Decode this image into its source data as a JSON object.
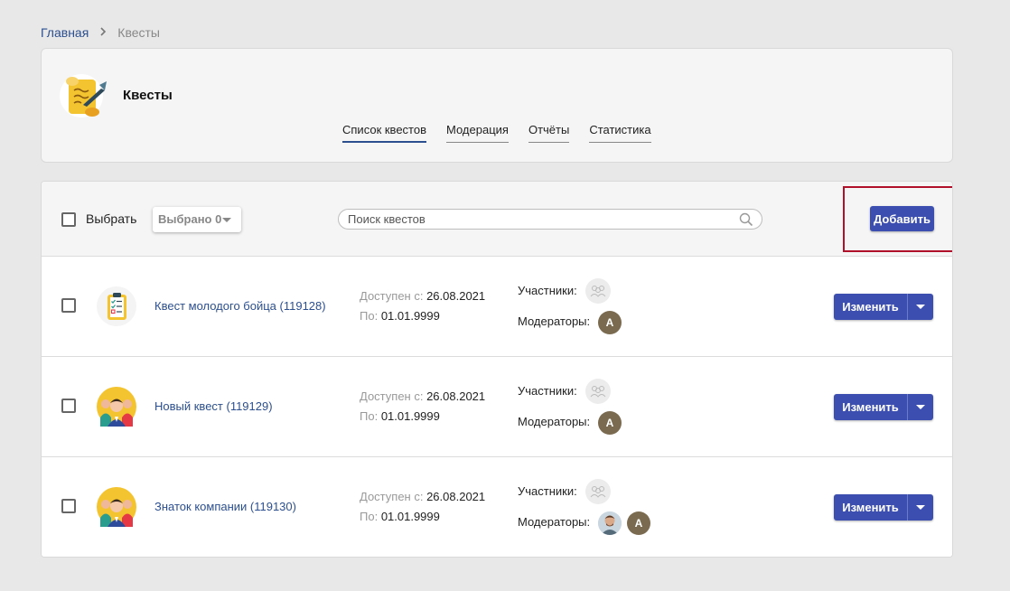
{
  "breadcrumb": {
    "home": "Главная",
    "current": "Квесты"
  },
  "header": {
    "title": "Квесты",
    "tabs": [
      {
        "label": "Список квестов",
        "active": true
      },
      {
        "label": "Модерация",
        "active": false
      },
      {
        "label": "Отчёты",
        "active": false
      },
      {
        "label": "Статистика",
        "active": false
      }
    ]
  },
  "toolbar": {
    "select_label": "Выбрать",
    "selected_label": "Выбрано 0",
    "search_placeholder": "Поиск квестов",
    "add_label": "Добавить"
  },
  "labels": {
    "available_from": "Доступен с:",
    "until": "По:",
    "participants": "Участники:",
    "moderators": "Модераторы:",
    "edit": "Изменить"
  },
  "quests": [
    {
      "name": "Квест молодого бойца (119128)",
      "available_from": "26.08.2021",
      "until": "01.01.9999",
      "icon": "checklist-icon",
      "moderators": [
        "A"
      ]
    },
    {
      "name": "Новый квест (119129)",
      "available_from": "26.08.2021",
      "until": "01.01.9999",
      "icon": "team-icon",
      "moderators": [
        "A"
      ]
    },
    {
      "name": "Знаток компании (119130)",
      "available_from": "26.08.2021",
      "until": "01.01.9999",
      "icon": "team-icon",
      "moderators": [
        "photo",
        "A"
      ]
    }
  ],
  "colors": {
    "accent": "#3c4fb0",
    "link": "#2c4f8f",
    "highlight": "#b0102a"
  }
}
